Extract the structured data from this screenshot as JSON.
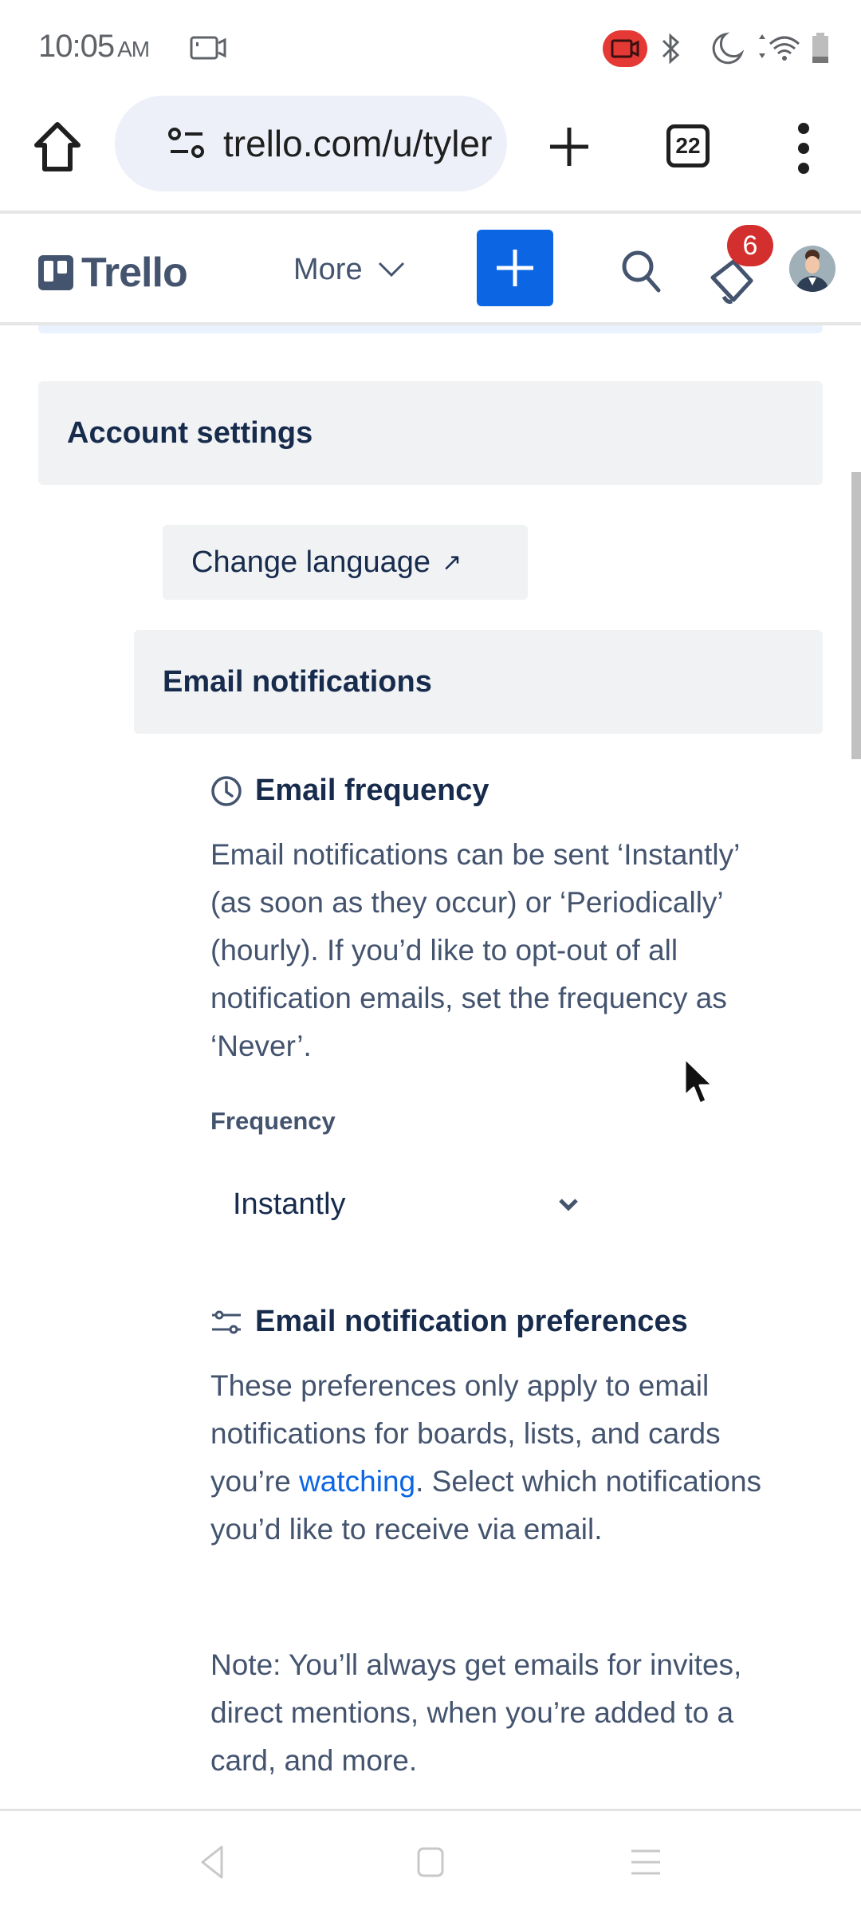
{
  "status_bar": {
    "time": "10:05",
    "ampm": "AM",
    "icons": [
      "screen-cast-icon",
      "screen-record-icon",
      "bluetooth-icon",
      "do-not-disturb-icon",
      "wifi-icon",
      "battery-icon"
    ]
  },
  "browser": {
    "url": "trello.com/u/tyler",
    "tab_count": "22",
    "icons": [
      "home-icon",
      "site-settings-icon",
      "new-tab-icon",
      "tab-switcher-icon",
      "more-vert-icon"
    ]
  },
  "header": {
    "logo_text": "Trello",
    "more_label": "More",
    "notification_count": "6",
    "colors": {
      "brand_text": "#44546f",
      "create_button": "#0c66e4",
      "badge": "#d32f2f"
    }
  },
  "content": {
    "account_settings": "Account settings",
    "change_language": "Change language",
    "change_language_icon": "↗",
    "email_notifications": "Email notifications",
    "email_frequency": {
      "heading": "Email frequency",
      "description": "Email notifications can be sent ‘Instantly’ (as soon as they occur) or ‘Periodically’ (hourly). If you’d like to opt-out of all notification emails, set the frequency as ‘Never’.",
      "field_label": "Frequency",
      "selected_value": "Instantly"
    },
    "preferences": {
      "heading": "Email notification preferences",
      "description_before_link": "These preferences only apply to email notifications for boards, lists, and cards you’re ",
      "link_text": "watching",
      "description_after_link": ". Select which notifications you’d like to receive via email.",
      "note": "Note: You’ll always get emails for invites, direct mentions, when you’re added to a card, and more."
    },
    "colors": {
      "link": "#0c66e4",
      "section_bg": "#f1f2f4",
      "heading": "#172b4d",
      "body": "#44546f"
    }
  },
  "nav_bar": {
    "icons": [
      "back-icon",
      "home-icon",
      "recents-icon"
    ]
  }
}
